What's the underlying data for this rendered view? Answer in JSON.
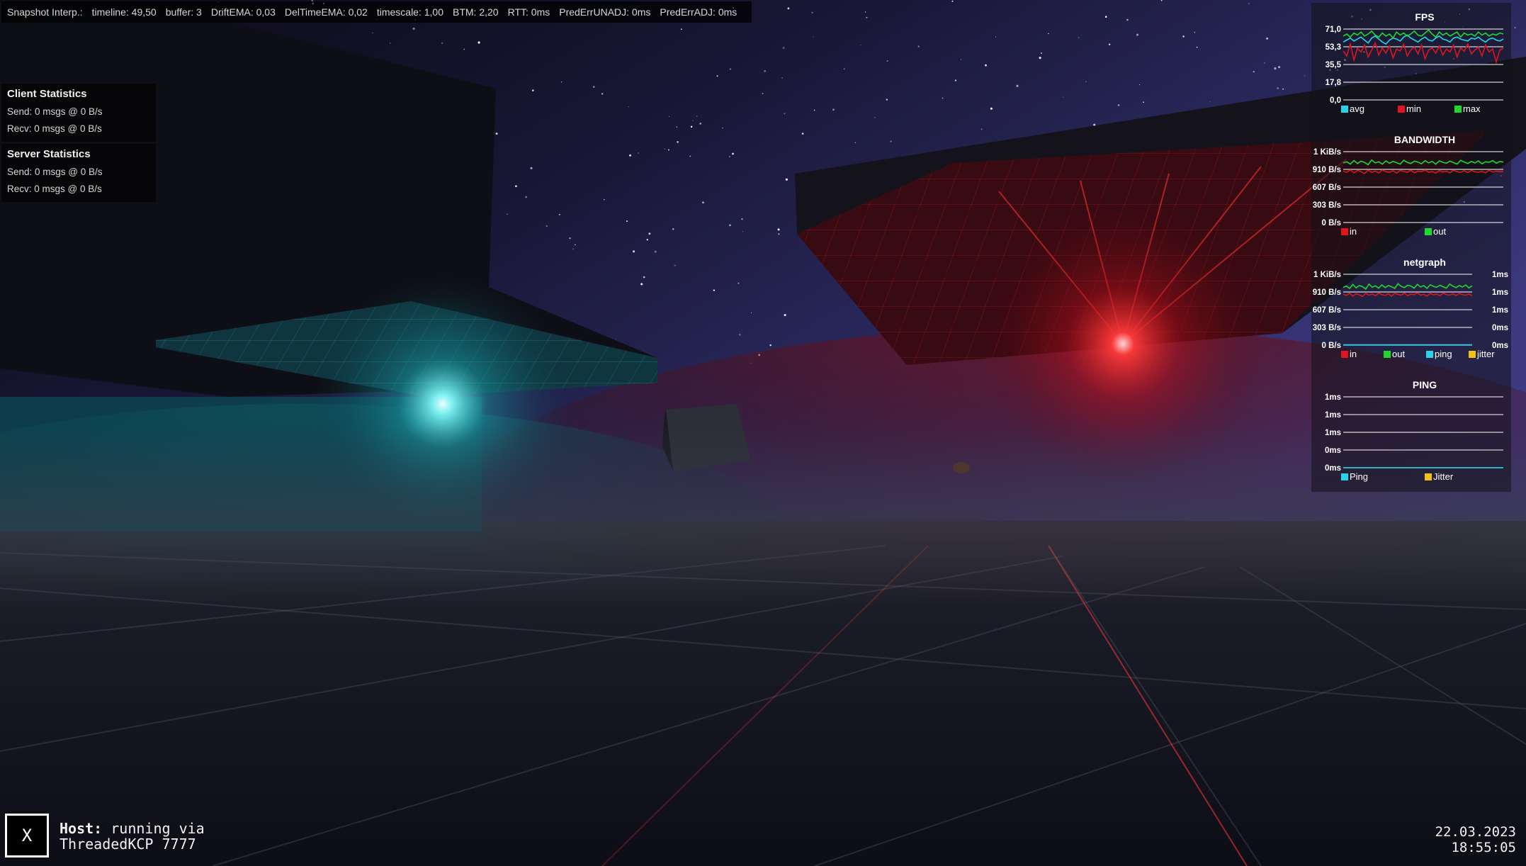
{
  "snapshot_bar": {
    "label": "Snapshot Interp.:",
    "timeline": "timeline: 49,50",
    "buffer": "buffer: 3",
    "drift_ema": "DriftEMA: 0,03",
    "del_time_ema": "DelTimeEMA: 0,02",
    "timescale": "timescale: 1,00",
    "btm": "BTM: 2,20",
    "rtt": "RTT: 0ms",
    "pred_err_unadj": "PredErrUNADJ: 0ms",
    "pred_err_adj": "PredErrADJ: 0ms"
  },
  "client_stats": {
    "title": "Client Statistics",
    "send": "Send: 0 msgs @ 0 B/s",
    "recv": "Recv: 0 msgs @ 0 B/s"
  },
  "server_stats": {
    "title": "Server Statistics",
    "send": "Send: 0 msgs @ 0 B/s",
    "recv": "Recv: 0 msgs @ 0 B/s"
  },
  "host_button": {
    "label": "X"
  },
  "host_status": {
    "prefix": "Host:",
    "line1": "running via",
    "line2": "ThreadedKCP 7777"
  },
  "clock": {
    "date": "22.03.2023",
    "time": "18:55:05"
  },
  "colors": {
    "cyan": "#27d3e8",
    "red": "#e0141c",
    "green": "#1fd82c",
    "yellow": "#f2c012",
    "scene_cyan_light": "#6ff2f2",
    "scene_red_light": "#ff2a2a"
  },
  "graphs": [
    {
      "title": "FPS",
      "y_ticks": [
        "71,0",
        "53,3",
        "35,5",
        "17,8",
        "0,0"
      ],
      "y_range": [
        0,
        71
      ],
      "legend": [
        {
          "label": "avg",
          "color": "#27d3e8"
        },
        {
          "label": "min",
          "color": "#e0141c"
        },
        {
          "label": "max",
          "color": "#1fd82c"
        }
      ],
      "series": [
        {
          "name": "avg",
          "color": "#27d3e8",
          "values": [
            58,
            60,
            62,
            59,
            61,
            63,
            60,
            57,
            62,
            64,
            61,
            58,
            56,
            60,
            62,
            61,
            59,
            63,
            65,
            62,
            60,
            58,
            61,
            63,
            60,
            59,
            62,
            64,
            61,
            60,
            58,
            62,
            63,
            61,
            60,
            59,
            62,
            61,
            63,
            60,
            58,
            61,
            62,
            60,
            59,
            61
          ]
        },
        {
          "name": "min",
          "color": "#e0141c",
          "values": [
            49,
            44,
            56,
            40,
            52,
            48,
            55,
            43,
            50,
            57,
            45,
            52,
            47,
            54,
            42,
            51,
            49,
            56,
            44,
            50,
            53,
            46,
            55,
            41,
            50,
            52,
            47,
            54,
            45,
            51,
            48,
            55,
            43,
            52,
            49,
            56,
            46,
            50,
            53,
            44,
            55,
            48,
            51,
            38,
            50,
            52
          ]
        },
        {
          "name": "max",
          "color": "#1fd82c",
          "values": [
            64,
            66,
            63,
            67,
            65,
            68,
            64,
            66,
            69,
            65,
            63,
            67,
            64,
            66,
            62,
            68,
            65,
            67,
            64,
            66,
            69,
            65,
            64,
            67,
            70,
            66,
            63,
            68,
            65,
            67,
            64,
            66,
            68,
            63,
            67,
            65,
            66,
            64,
            68,
            65,
            67,
            64,
            66,
            65,
            67,
            66
          ]
        }
      ]
    },
    {
      "title": "BANDWIDTH",
      "y_ticks": [
        "1 KiB/s",
        "910 B/s",
        "607 B/s",
        "303 B/s",
        "0 B/s"
      ],
      "y_range": [
        0,
        1213
      ],
      "legend": [
        {
          "label": "in",
          "color": "#e0141c"
        },
        {
          "label": "out",
          "color": "#1fd82c"
        }
      ],
      "series": [
        {
          "name": "in",
          "color": "#e0141c",
          "values": [
            880,
            860,
            900,
            850,
            890,
            870,
            840,
            895,
            860,
            880,
            850,
            900,
            870,
            860,
            885,
            845,
            890,
            875,
            860,
            895,
            850,
            880,
            870,
            900,
            860,
            875,
            845,
            890,
            865,
            880,
            850,
            895,
            870,
            860,
            885,
            855,
            890,
            870,
            860,
            880,
            850,
            895,
            865,
            880,
            870,
            875
          ]
        },
        {
          "name": "out",
          "color": "#1fd82c",
          "values": [
            1020,
            1040,
            1000,
            1060,
            1010,
            1050,
            1030,
            990,
            1070,
            1020,
            1040,
            1000,
            1055,
            1015,
            1045,
            1025,
            1000,
            1065,
            1030,
            1010,
            1050,
            1035,
            1005,
            1060,
            1020,
            1045,
            1000,
            1055,
            1030,
            1015,
            1050,
            1025,
            1000,
            1065,
            1035,
            1010,
            1045,
            1020,
            1055,
            1005,
            1040,
            1030,
            1060,
            1015,
            1045,
            1035
          ]
        }
      ]
    },
    {
      "title": "netgraph",
      "y_ticks": [
        "1 KiB/s",
        "910 B/s",
        "607 B/s",
        "303 B/s",
        "0 B/s"
      ],
      "y_ticks_right": [
        "1ms",
        "1ms",
        "1ms",
        "0ms",
        "0ms"
      ],
      "y_range": [
        0,
        1213
      ],
      "legend": [
        {
          "label": "in",
          "color": "#e0141c"
        },
        {
          "label": "out",
          "color": "#1fd82c"
        },
        {
          "label": "ping",
          "color": "#27d3e8"
        },
        {
          "label": "jitter",
          "color": "#f2c012"
        }
      ],
      "series": [
        {
          "name": "in",
          "color": "#e0141c",
          "values": [
            870,
            850,
            890,
            840,
            880,
            860,
            835,
            885,
            855,
            875,
            845,
            890,
            865,
            850,
            880,
            840,
            885,
            870,
            855,
            890,
            845,
            875,
            865,
            895,
            855,
            870,
            840,
            885,
            860,
            875,
            845,
            890,
            865,
            855,
            880,
            850,
            885,
            865,
            855,
            875,
            845
          ]
        },
        {
          "name": "out",
          "color": "#1fd82c",
          "values": [
            990,
            1010,
            970,
            1040,
            980,
            1020,
            1000,
            960,
            1045,
            990,
            1015,
            975,
            1030,
            985,
            1020,
            1000,
            970,
            1050,
            1005,
            985,
            1025,
            1010,
            975,
            1040,
            995,
            1020,
            970,
            1035,
            1005,
            990,
            1025,
            1000,
            975,
            1045,
            1010,
            985,
            1020,
            995,
            1030,
            980,
            1015
          ]
        },
        {
          "name": "ping",
          "color": "#27d3e8",
          "values": [
            5,
            5,
            5,
            5,
            5,
            5,
            5,
            5,
            5,
            5,
            5,
            5,
            5,
            5,
            5,
            5,
            5,
            5,
            5,
            5,
            5,
            5,
            5,
            5,
            5,
            5,
            5,
            5,
            5,
            5,
            5,
            5,
            5,
            5,
            5,
            5,
            5,
            5,
            5,
            5,
            5
          ]
        }
      ]
    },
    {
      "title": "PING",
      "y_ticks": [
        "1ms",
        "1ms",
        "1ms",
        "0ms",
        "0ms"
      ],
      "y_range": [
        0,
        1
      ],
      "legend": [
        {
          "label": "Ping",
          "color": "#27d3e8"
        },
        {
          "label": "Jitter",
          "color": "#f2c012"
        }
      ],
      "series": [
        {
          "name": "Ping",
          "color": "#27d3e8",
          "values": [
            0,
            0,
            0,
            0,
            0,
            0,
            0,
            0,
            0,
            0,
            0,
            0,
            0,
            0,
            0,
            0,
            0,
            0,
            0,
            0,
            0,
            0,
            0,
            0,
            0,
            0,
            0,
            0,
            0,
            0,
            0,
            0,
            0,
            0,
            0,
            0,
            0,
            0,
            0,
            0,
            0,
            0,
            0,
            0,
            0,
            0
          ]
        }
      ]
    }
  ]
}
